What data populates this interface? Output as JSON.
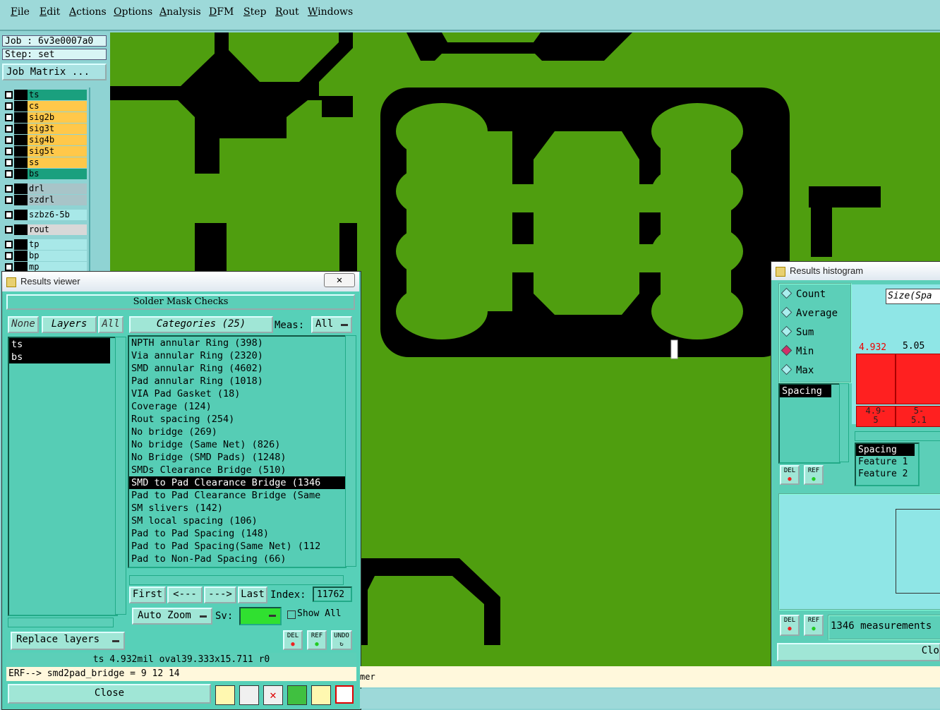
{
  "menu": [
    "File",
    "Edit",
    "Actions",
    "Options",
    "Analysis",
    "DFM",
    "Step",
    "Rout",
    "Windows"
  ],
  "job": {
    "label": "Job : 6v3e0007a0",
    "step": "Step: set",
    "matrix_button": "Job Matrix ..."
  },
  "layers": [
    {
      "name": "ts",
      "color": "#1aa07e"
    },
    {
      "name": "cs",
      "color": "#ffc84a"
    },
    {
      "name": "sig2b",
      "color": "#ffc84a"
    },
    {
      "name": "sig3t",
      "color": "#ffc84a"
    },
    {
      "name": "sig4b",
      "color": "#ffc84a"
    },
    {
      "name": "sig5t",
      "color": "#ffc84a"
    },
    {
      "name": "ss",
      "color": "#ffc84a"
    },
    {
      "name": "bs",
      "color": "#1aa07e"
    },
    {
      "name": "drl",
      "color": "#a8c4c8"
    },
    {
      "name": "szdrl",
      "color": "#a8c4c8"
    },
    {
      "name": "szbz6-5b",
      "color": "#a8e8e8"
    },
    {
      "name": "rout",
      "color": "#d8d8d8"
    },
    {
      "name": "tp",
      "color": "#a8e8e8"
    },
    {
      "name": "bp",
      "color": "#a8e8e8"
    },
    {
      "name": "mp",
      "color": "#a8e8e8"
    }
  ],
  "results_viewer": {
    "title": "Results viewer",
    "header": "Solder Mask Checks",
    "none_btn": "None",
    "layers_btn": "Layers",
    "all_btn": "All",
    "categories_btn": "Categories (25)",
    "meas_label": "Meas:",
    "meas_value": "All",
    "layer_list": [
      "ts",
      "bs"
    ],
    "categories": [
      "NPTH annular Ring (398)",
      "Via annular Ring (2320)",
      "SMD annular Ring (4602)",
      "Pad annular Ring (1018)",
      "VIA Pad Gasket (18)",
      "Coverage (124)",
      "Rout spacing (254)",
      "No bridge (269)",
      "No bridge (Same Net) (826)",
      "No Bridge (SMD Pads) (1248)",
      "SMDs Clearance Bridge (510)",
      "SMD to Pad Clearance Bridge (1346",
      "Pad to Pad Clearance Bridge (Same",
      "SM slivers (142)",
      "SM local spacing (106)",
      "Pad to Pad Spacing (148)",
      "Pad to Pad Spacing(Same Net) (112",
      "Pad to Non-Pad Spacing (66)"
    ],
    "selected_index": 11,
    "first_btn": "First",
    "prev_btn": "<---",
    "next_btn": "--->",
    "last_btn": "Last",
    "index_label": "Index:",
    "index_value": "11762",
    "auto_zoom": "Auto Zoom",
    "sv_label": "Sv:",
    "show_all": "Show All",
    "replace_layers": "Replace layers",
    "del": "DEL",
    "ref": "REF",
    "undo": "UNDO",
    "status": "ts 4.932mil  oval39.333x15.711  r0",
    "erf": "ERF--> smd2pad_bridge = 9 12 14",
    "close": "Close"
  },
  "histogram": {
    "title": "Results histogram",
    "options": [
      "Count",
      "Average",
      "Sum",
      "Min",
      "Max"
    ],
    "selected": "Min",
    "param_list": [
      "Spacing"
    ],
    "header": "Size(Spa",
    "bars": [
      {
        "value": "4.932",
        "label": "4.9-\n5",
        "color": "#ff2020"
      },
      {
        "value": "5.05",
        "label": "5-\n5.1",
        "color": "#ff2020"
      }
    ],
    "legend": [
      "Spacing",
      "Feature 1",
      "Feature 2"
    ],
    "measurements": "1346 measurements",
    "close": "Clo",
    "del": "DEL",
    "ref": "REF"
  },
  "bottom_text": "mer"
}
